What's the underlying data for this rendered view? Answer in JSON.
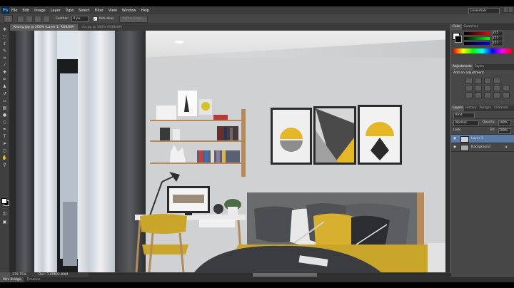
{
  "app": {
    "logo": "Ps"
  },
  "menu": [
    "File",
    "Edit",
    "Image",
    "Layer",
    "Type",
    "Select",
    "Filter",
    "View",
    "Window",
    "Help"
  ],
  "workspace": {
    "label": "Essentials"
  },
  "options": {
    "tool_icon": "⬚",
    "feather_label": "Feather:",
    "feather_value": "0 px",
    "antialias_check": "✓",
    "antialias_label": "Anti-alias",
    "refine_label": "Refine Edge..."
  },
  "document_tabs": [
    {
      "label": "Khong.jpg @ 200% (Layer 1, RGB/8#)",
      "active": true
    },
    {
      "label": "no.jpg @ 100% (RGB/8#)",
      "active": false
    }
  ],
  "status": {
    "zoom": "379.75%",
    "doc": "Doc: 1.09M/2.80M"
  },
  "bottom_tabs": [
    {
      "label": "Mini Bridge",
      "active": true
    },
    {
      "label": "Timeline",
      "active": false
    }
  ],
  "color_panel": {
    "tabs": [
      {
        "label": "Color",
        "active": true
      },
      {
        "label": "Swatches",
        "active": false
      }
    ],
    "values": [
      "255",
      "255",
      "255"
    ]
  },
  "adjustments_panel": {
    "tabs": [
      {
        "label": "Adjustments",
        "active": true
      },
      {
        "label": "Styles",
        "active": false
      }
    ],
    "title": "Add an adjustment"
  },
  "layers_panel": {
    "tabs": [
      {
        "label": "Layers",
        "active": true
      },
      {
        "label": "History",
        "active": false
      },
      {
        "label": "Paragra",
        "active": false
      },
      {
        "label": "Channels",
        "active": false
      }
    ],
    "filter_label": "Kind",
    "blend_mode": "Normal",
    "opacity_label": "Opacity:",
    "opacity_value": "100%",
    "lock_label": "Lock:",
    "fill_label": "Fill:",
    "fill_value": "100%",
    "layers": [
      {
        "name": "Layer 1",
        "selected": true
      },
      {
        "name": "Background",
        "selected": false
      }
    ]
  },
  "colors": {
    "accent": "#5b7aa5",
    "panel": "#474747",
    "chrome": "#3c3c3c"
  }
}
